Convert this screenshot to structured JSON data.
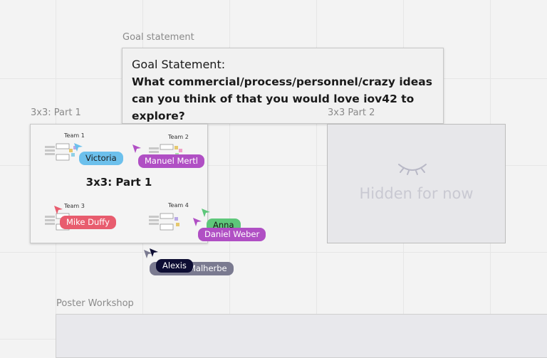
{
  "frames": {
    "goal": {
      "label": "Goal statement",
      "heading": "Goal Statement:",
      "question": "What commercial/process/personnel/crazy ideas can you think of that you would love iov42 to explore?"
    },
    "part1": {
      "label": "3x3: Part 1",
      "title": "3x3: Part 1",
      "teams": [
        "Team 1",
        "Team 2",
        "Team 3",
        "Team 4"
      ]
    },
    "part2": {
      "label": "3x3 Part 2",
      "hidden_text": "Hidden for now"
    },
    "poster": {
      "label": "Poster Workshop"
    }
  },
  "collaborators": [
    {
      "name": "Victoria",
      "color": "#6cc0ec",
      "text_color": "#1a1a1a"
    },
    {
      "name": "Manuel Mertl",
      "color": "#b04fc4",
      "text_color": "#ffffff"
    },
    {
      "name": "Mike Duffy",
      "color": "#e85c6e",
      "text_color": "#ffffff"
    },
    {
      "name": "Anna",
      "color": "#5ec77a",
      "text_color": "#1a1a1a"
    },
    {
      "name": "Daniel Weber",
      "color": "#b04fc4",
      "text_color": "#ffffff"
    },
    {
      "name": "Malherbe",
      "color": "#7a7a90",
      "text_color": "#ffffff"
    },
    {
      "name": "Alexis",
      "color": "#0d0d33",
      "text_color": "#ffffff"
    }
  ],
  "colors": {
    "canvas": "#f3f3f3",
    "frame_bg": "#f1f1f1",
    "label_gray": "#8a8a8a"
  }
}
